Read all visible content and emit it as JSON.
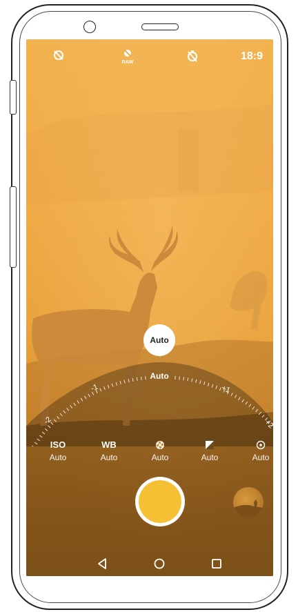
{
  "top_bar": {
    "icons": [
      "rotate-off-icon",
      "raw-icon",
      "timer-off-icon"
    ],
    "raw_label": "RAW",
    "aspect_ratio": "18:9"
  },
  "exposure": {
    "bubble_value": "Auto",
    "dial_center_label": "Auto",
    "dial_labels": [
      "-2",
      "-1",
      "+1",
      "+2"
    ],
    "dial_level": 0
  },
  "settings": [
    {
      "name": "iso",
      "title": "ISO",
      "value": "Auto"
    },
    {
      "name": "wb",
      "title": "WB",
      "value": "Auto"
    },
    {
      "name": "aperture",
      "icon": "aperture-icon",
      "value": "Auto"
    },
    {
      "name": "exposure",
      "icon": "exposure-icon",
      "value": "Auto"
    },
    {
      "name": "focus",
      "icon": "focus-icon",
      "value": "Auto"
    }
  ],
  "colors": {
    "accent": "#f6c034",
    "scene_warm": "#efaa45"
  },
  "nav": {
    "icons": [
      "back-icon",
      "home-icon",
      "recents-icon"
    ]
  }
}
